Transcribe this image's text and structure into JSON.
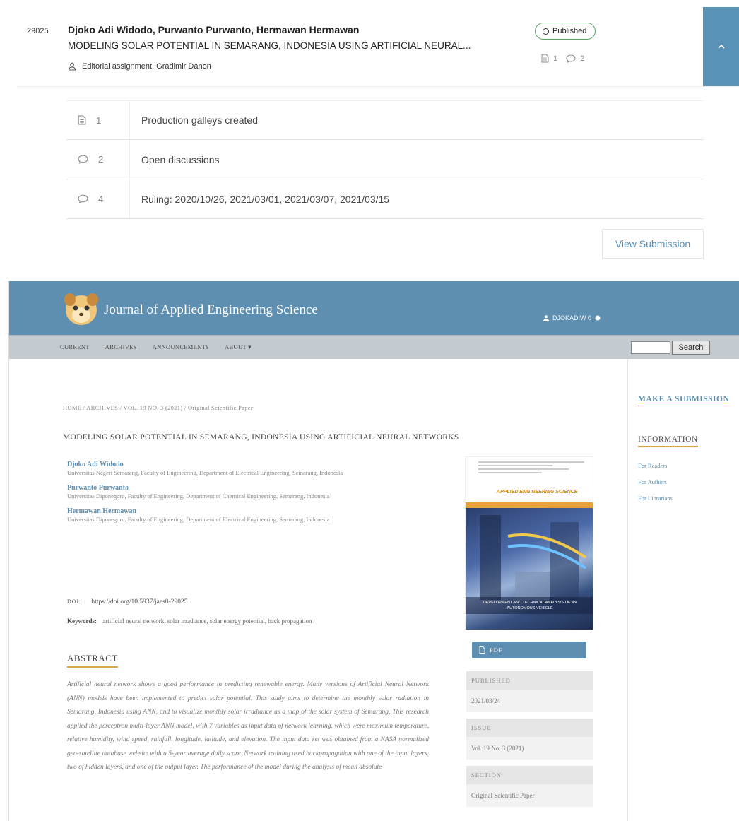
{
  "submission": {
    "id": "29025",
    "authors": "Djoko Adi Widodo, Purwanto Purwanto, Hermawan Hermawan",
    "title": "MODELING SOLAR POTENTIAL IN SEMARANG, INDONESIA USING ARTIFICIAL NEURAL...",
    "editor": "Editorial assignment: Gradimir Danon",
    "status": "Published",
    "stat_files": "1",
    "stat_discussions": "2",
    "activity": [
      {
        "count": "1",
        "icon": "file-icon",
        "label": "Production galleys created"
      },
      {
        "count": "2",
        "icon": "comment-icon",
        "label": "Open discussions"
      },
      {
        "count": "4",
        "icon": "comment-icon",
        "label": "Ruling: 2020/10/26, 2021/03/01, 2021/03/07, 2021/03/15"
      }
    ],
    "view_button": "View Submission"
  },
  "journal": {
    "name": "Journal of Applied Engineering Science",
    "user": "DJOKADIW 0",
    "nav": [
      "CURRENT",
      "ARCHIVES",
      "ANNOUNCEMENTS",
      "ABOUT ▾"
    ],
    "search_button": "Search",
    "breadcrumb": "HOME / ARCHIVES / VOL. 19 NO. 3 (2021) / Original Scientific Paper",
    "article_title": "MODELING SOLAR POTENTIAL IN SEMARANG, INDONESIA USING ARTIFICIAL NEURAL NETWORKS",
    "authors": [
      {
        "name": "Djoko Adi Widodo",
        "affiliation": "Universitas Negeri Semarang, Faculty of Engineering, Department of Electrical Engineering, Semarang, Indonesia"
      },
      {
        "name": "Purwanto Purwanto",
        "affiliation": "Universitas Diponegoro, Faculty of Engineering, Department of Chemical Engineering, Semarang, Indonesia"
      },
      {
        "name": "Hermawan Hermawan",
        "affiliation": "Universitas Diponegoro, Faculty of Engineering, Department of Electrical Engineering, Semarang, Indonesia"
      }
    ],
    "doi_label": "DOI:",
    "doi": "https://doi.org/10.5937/jaes0-29025",
    "keywords_label": "Keywords:",
    "keywords": "artificial neural network, solar irradiance, solar energy potential, back propagation",
    "abstract_heading": "ABSTRACT",
    "abstract": "Artificial neural network shows a good performance in predicting renewable energy. Many versions of Artificial Neural Network (ANN) models have been implemented to predict solar potential. This study aims to determine the monthly solar radiation in Semarang, Indonesia using ANN, and to visualize monthly solar irradiance as a map of the solar system of Semarang. This research applied the perceptron multi-layer ANN model, with 7 variables as input data of network learning, which were maximum temperature, relative humidity, wind speed, rainfall, longitude, latitude, and elevation. The input data set was obtained from a NASA normalized geo-satellite database website with a 5-year average daily score. Network training used backpropagation with one of the input layers, two of hidden layers, and one of the output layer. The performance of the model during the analysis of mean absolute",
    "cover_journal": "APPLIED ENGINEERING SCIENCE",
    "cover_caption": "DEVELOPMENT AND TECHNICAL ANALYSIS OF AN AUTONOMOUS VEHICLE",
    "pdf_label": "PDF",
    "published_label": "PUBLISHED",
    "published_value": "2021/03/24",
    "issue_label": "ISSUE",
    "issue_value": "Vol. 19 No. 3 (2021)",
    "section_label": "SECTION",
    "section_value": "Original Scientific Paper",
    "make_submission": "MAKE A SUBMISSION",
    "information_heading": "INFORMATION",
    "info_links": [
      "For Readers",
      "For Authors",
      "For Librarians"
    ]
  },
  "colors": {
    "accent": "#5e8fb0",
    "status_border": "#5aa466",
    "underline": "#d9a441"
  }
}
